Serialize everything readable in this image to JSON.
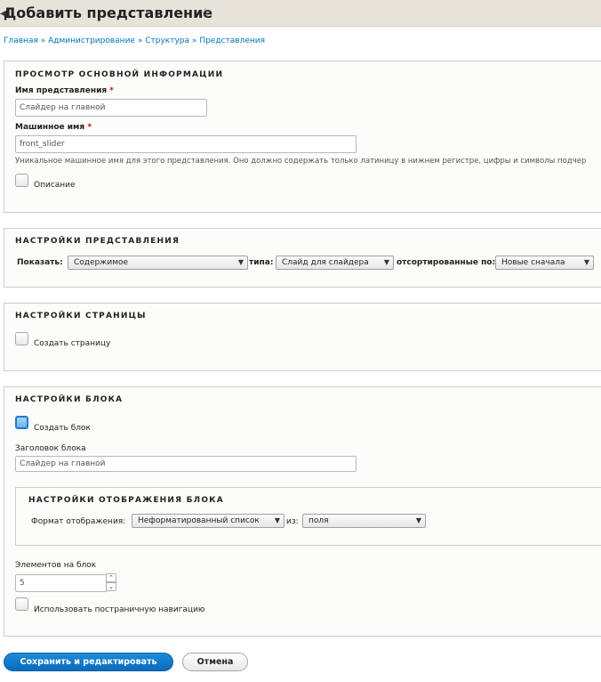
{
  "header": {
    "title": "Добавить представление",
    "back_icon": "arrow-left-icon",
    "star_icon": "star-outline-icon"
  },
  "breadcrumb": {
    "items": [
      "Главная",
      "Администрирование",
      "Структура",
      "Представления"
    ],
    "separator": "»"
  },
  "basic_info": {
    "legend": "ПРОСМОТР ОСНОВНОЙ ИНФОРМАЦИИ",
    "view_name_label": "Имя представления",
    "view_name_value": "Слайдер на главной",
    "machine_name_label": "Машинное имя",
    "machine_name_value": "front_slider",
    "machine_name_desc": "Уникальное машинное имя для этого представления. Оно должно содержать только латиницу в нижнем регистре, цифры и символы подчер",
    "description_checkbox_label": "Описание",
    "required_marker": "*"
  },
  "view_settings": {
    "legend": "НАСТРОЙКИ ПРЕДСТАВЛЕНИЯ",
    "show_label": "Показать:",
    "show_value": "Содержимое",
    "type_label": "типа:",
    "type_value": "Слайд для слайдера",
    "sorted_label": "отсортированные по:",
    "sorted_value": "Новые сначала"
  },
  "page_settings": {
    "legend": "НАСТРОЙКИ СТРАНИЦЫ",
    "create_page_label": "Создать страницу"
  },
  "block_settings": {
    "legend": "НАСТРОЙКИ БЛОКА",
    "create_block_label": "Создать блок",
    "create_block_checked": true,
    "block_title_label": "Заголовок блока",
    "block_title_value": "Слайдер на главной",
    "display": {
      "legend": "НАСТРОЙКИ ОТОБРАЖЕНИЯ БЛОКА",
      "format_label": "Формат отображения:",
      "format_value": "Неформатированный список",
      "of_label": "из:",
      "of_value": "поля"
    },
    "items_per_block_label": "Элементов на блок",
    "items_per_block_value": "5",
    "pager_label": "Использовать постраничную навигацию"
  },
  "actions": {
    "save_label": "Сохранить и редактировать",
    "cancel_label": "Отмена"
  },
  "colors": {
    "link": "#0074bd",
    "primary_button": "#0a6bbd",
    "header_bg": "#e6e4da",
    "required": "#e20000"
  }
}
